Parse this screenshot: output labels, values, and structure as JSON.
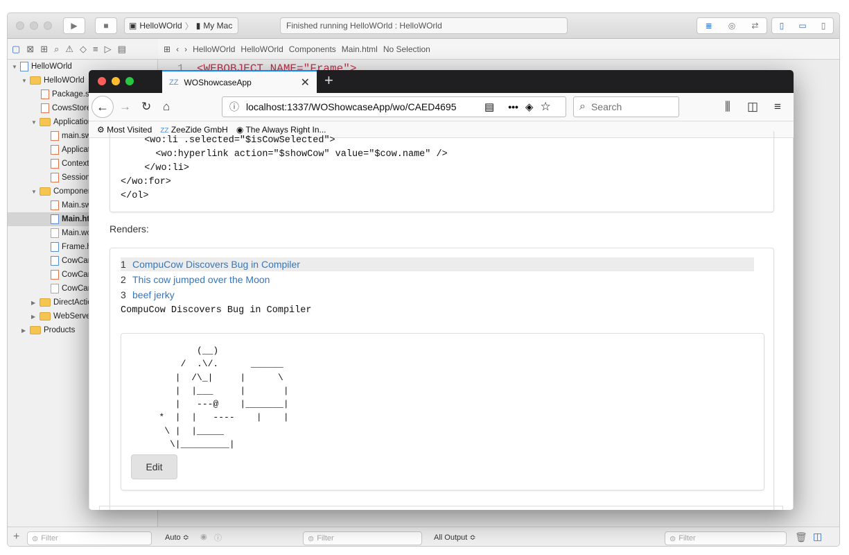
{
  "xcode": {
    "scheme": {
      "project": "HelloWOrld",
      "device": "My Mac"
    },
    "status": "Finished running HelloWOrld : HelloWOrld",
    "jumpbar": [
      "HelloWOrld",
      "HelloWOrld",
      "Components",
      "Main.html",
      "No Selection"
    ],
    "code_line": {
      "num": "1",
      "text": "<WEBOBJECT NAME=\"Frame\">"
    },
    "navigator": [
      {
        "label": "HelloWOrld"
      },
      {
        "label": "HelloWOrld"
      },
      {
        "label": "Package.swift"
      },
      {
        "label": "CowsStore.swift"
      },
      {
        "label": "Application"
      },
      {
        "label": "main.swift"
      },
      {
        "label": "Application.swift"
      },
      {
        "label": "Context.swift"
      },
      {
        "label": "Session.swift"
      },
      {
        "label": "Components"
      },
      {
        "label": "Main.swift"
      },
      {
        "label": "Main.html"
      },
      {
        "label": "Main.wod"
      },
      {
        "label": "Frame.html"
      },
      {
        "label": "CowCard.html"
      },
      {
        "label": "CowCard.swift"
      },
      {
        "label": "CowCard.wod"
      },
      {
        "label": "DirectActions"
      },
      {
        "label": "WebServer"
      },
      {
        "label": "Products"
      }
    ],
    "bottom": {
      "filter1": "Filter",
      "auto": "Auto ≎",
      "filter2": "Filter",
      "output": "All Output ≎",
      "filter3": "Filter"
    }
  },
  "browser": {
    "tab_title": "WOShowcaseApp",
    "url": "localhost:1337/WOShowcaseApp/wo/CAED4695",
    "search_placeholder": "Search",
    "bookmarks": [
      "Most Visited",
      "ZeeZide GmbH",
      "The Always Right In..."
    ]
  },
  "page": {
    "code_lines": [
      "  <wo:li .selected=\"$isCowSelected\">",
      "    <wo:hyperlink action=\"$showCow\" value=\"$cow.name\" />",
      "  </wo:li>",
      "</wo:for>",
      "</ol>"
    ],
    "renders_label": "Renders:",
    "list": [
      {
        "num": "1",
        "name": "CompuCow Discovers Bug in Compiler",
        "selected": true
      },
      {
        "num": "2",
        "name": "This cow jumped over the Moon",
        "selected": false
      },
      {
        "num": "3",
        "name": "beef jerky",
        "selected": false
      }
    ],
    "selected_name": "CompuCow Discovers Bug in Compiler",
    "cow_art": "          (__)\n       /  .\\/.      ______\n      |  /\\_|     |      \\\n      |  |___     |       |\n      |   ---@    |_______|\n   *  |  |   ----    |    |\n    \\ |  |_____\n     \\|_________|",
    "edit_label": "Edit"
  }
}
